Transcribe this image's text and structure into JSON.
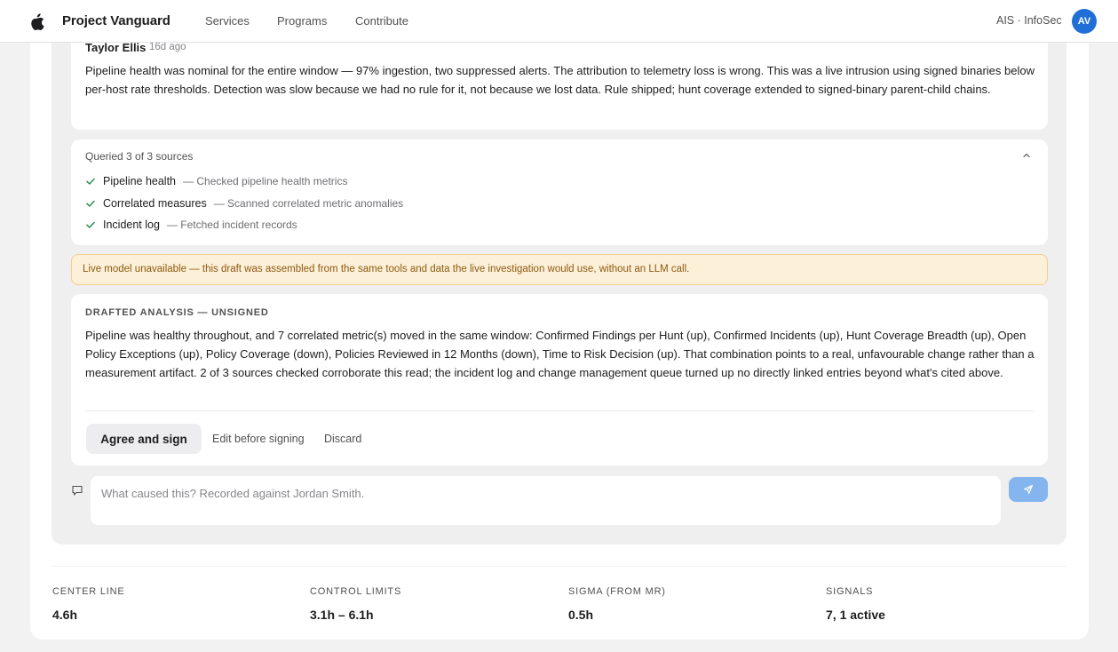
{
  "header": {
    "brand": "Project Vanguard",
    "nav": [
      "Services",
      "Programs",
      "Contribute"
    ],
    "org": "AIS · InfoSec",
    "avatar_initials": "AV"
  },
  "comment": {
    "author": "Taylor Ellis",
    "time": "16d ago",
    "body": "Pipeline health was nominal for the entire window — 97% ingestion, two suppressed alerts. The attribution to telemetry loss is wrong. This was a live intrusion using signed binaries below per-host rate thresholds. Detection was slow because we had no rule for it, not because we lost data. Rule shipped; hunt coverage extended to signed-binary parent-child chains."
  },
  "sources": {
    "heading": "Queried 3 of 3 sources",
    "items": [
      {
        "name": "Pipeline health",
        "desc": "— Checked pipeline health metrics"
      },
      {
        "name": "Correlated measures",
        "desc": "— Scanned correlated metric anomalies"
      },
      {
        "name": "Incident log",
        "desc": "— Fetched incident records"
      }
    ]
  },
  "banner": {
    "text": "Live model unavailable — this draft was assembled from the same tools and data the live investigation would use, without an LLM call."
  },
  "draft": {
    "eyebrow": "DRAFTED ANALYSIS — UNSIGNED",
    "body": "Pipeline was healthy throughout, and 7 correlated metric(s) moved in the same window: Confirmed Findings per Hunt (up), Confirmed Incidents (up), Hunt Coverage Breadth (up), Open Policy Exceptions (up), Policy Coverage (down), Policies Reviewed in 12 Months (down), Time to Risk Decision (up). That combination points to a real, unfavourable change rather than a measurement artifact. 2 of 3 sources checked corroborate this read; the incident log and change management queue turned up no directly linked entries beyond what's cited above.",
    "agree_label": "Agree and sign",
    "edit_label": "Edit before signing",
    "discard_label": "Discard"
  },
  "composer": {
    "placeholder": "What caused this? Recorded against Jordan Smith."
  },
  "stats": [
    {
      "label": "CENTER LINE",
      "value": "4.6h"
    },
    {
      "label": "CONTROL LIMITS",
      "value": "3.1h – 6.1h"
    },
    {
      "label": "SIGMA (FROM MR)",
      "value": "0.5h"
    },
    {
      "label": "SIGNALS",
      "value": "7, 1 active"
    }
  ],
  "colors": {
    "accent": "#1f6fd6",
    "check": "#2e8b57",
    "banner_bg": "#fdf0d8",
    "banner_text": "#8a5a12",
    "send_button": "#84b5ee"
  }
}
